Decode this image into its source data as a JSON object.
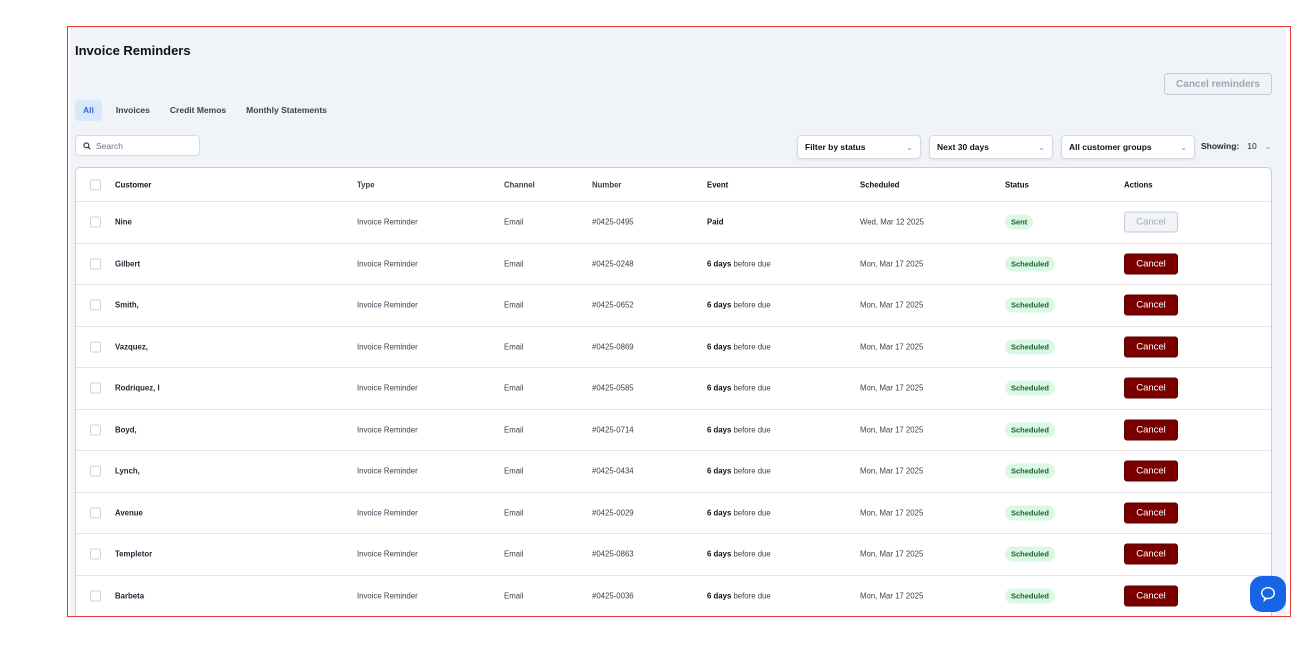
{
  "page": {
    "title": "Invoice Reminders",
    "cancel_reminders_label": "Cancel reminders"
  },
  "tabs": [
    {
      "label": "All",
      "active": true
    },
    {
      "label": "Invoices"
    },
    {
      "label": "Credit Memos"
    },
    {
      "label": "Monthly Statements"
    }
  ],
  "search": {
    "placeholder": "Search"
  },
  "filters": {
    "status": "Filter by status",
    "range": "Next 30 days",
    "groups": "All customer groups",
    "showing_label": "Showing:",
    "showing_value": "10"
  },
  "table": {
    "headers": [
      "Customer",
      "Type",
      "Channel",
      "Number",
      "Event",
      "Scheduled",
      "Status",
      "Actions"
    ],
    "rows": [
      {
        "customer": "Nine",
        "type": "Invoice Reminder",
        "channel": "Email",
        "number": "#0425-0495",
        "event_bold": "Paid",
        "event_rest": "",
        "scheduled": "Wed, Mar 12 2025",
        "status": "Sent",
        "action": "Cancel",
        "disabled": true
      },
      {
        "customer": "Gilbert",
        "type": "Invoice Reminder",
        "channel": "Email",
        "number": "#0425-0248",
        "event_bold": "6 days",
        "event_rest": " before due",
        "scheduled": "Mon, Mar 17 2025",
        "status": "Scheduled",
        "action": "Cancel"
      },
      {
        "customer": "Smith,",
        "type": "Invoice Reminder",
        "channel": "Email",
        "number": "#0425-0652",
        "event_bold": "6 days",
        "event_rest": " before due",
        "scheduled": "Mon, Mar 17 2025",
        "status": "Scheduled",
        "action": "Cancel"
      },
      {
        "customer": "Vazquez,",
        "type": "Invoice Reminder",
        "channel": "Email",
        "number": "#0425-0869",
        "event_bold": "6 days",
        "event_rest": " before due",
        "scheduled": "Mon, Mar 17 2025",
        "status": "Scheduled",
        "action": "Cancel"
      },
      {
        "customer": "Rodriquez, I",
        "type": "Invoice Reminder",
        "channel": "Email",
        "number": "#0425-0585",
        "event_bold": "6 days",
        "event_rest": " before due",
        "scheduled": "Mon, Mar 17 2025",
        "status": "Scheduled",
        "action": "Cancel"
      },
      {
        "customer": "Boyd,",
        "type": "Invoice Reminder",
        "channel": "Email",
        "number": "#0425-0714",
        "event_bold": "6 days",
        "event_rest": " before due",
        "scheduled": "Mon, Mar 17 2025",
        "status": "Scheduled",
        "action": "Cancel"
      },
      {
        "customer": "Lynch,",
        "type": "Invoice Reminder",
        "channel": "Email",
        "number": "#0425-0434",
        "event_bold": "6 days",
        "event_rest": " before due",
        "scheduled": "Mon, Mar 17 2025",
        "status": "Scheduled",
        "action": "Cancel"
      },
      {
        "customer": "Avenue",
        "type": "Invoice Reminder",
        "channel": "Email",
        "number": "#0425-0029",
        "event_bold": "6 days",
        "event_rest": " before due",
        "scheduled": "Mon, Mar 17 2025",
        "status": "Scheduled",
        "action": "Cancel"
      },
      {
        "customer": "Templetor",
        "type": "Invoice Reminder",
        "channel": "Email",
        "number": "#0425-0863",
        "event_bold": "6 days",
        "event_rest": " before due",
        "scheduled": "Mon, Mar 17 2025",
        "status": "Scheduled",
        "action": "Cancel"
      },
      {
        "customer": "Barbeta",
        "type": "Invoice Reminder",
        "channel": "Email",
        "number": "#0425-0036",
        "event_bold": "6 days",
        "event_rest": " before due",
        "scheduled": "Mon, Mar 17 2025",
        "status": "Scheduled",
        "action": "Cancel"
      }
    ]
  },
  "colors": {
    "accent": "#2d6fd6",
    "cancel": "#7a0000",
    "badge_bg": "#dcf7e3",
    "chat": "#1565e6"
  }
}
